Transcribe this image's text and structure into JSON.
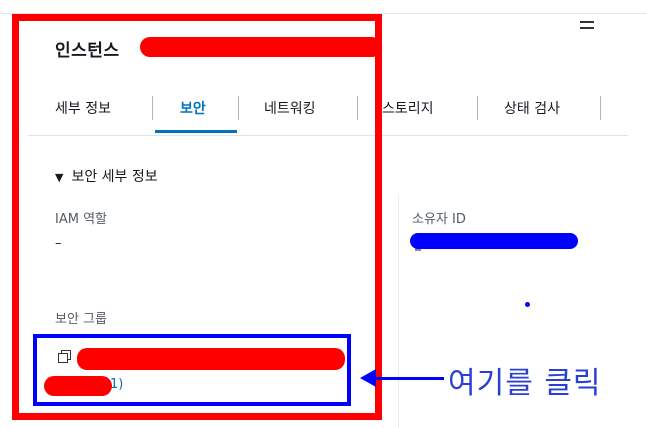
{
  "header": {
    "title": "인스턴스",
    "menu_icon": "hamburger-menu-icon"
  },
  "tabs": [
    {
      "label": "세부 정보",
      "active": false
    },
    {
      "label": "보안",
      "active": true
    },
    {
      "label": "네트워킹",
      "active": false
    },
    {
      "label": "스토리지",
      "active": false
    },
    {
      "label": "상태 검사",
      "active": false
    }
  ],
  "security_details": {
    "section_title": "보안 세부 정보",
    "iam_role_label": "IAM 역할",
    "iam_role_value": "–",
    "owner_id_label": "소유자 ID",
    "security_groups_label": "보안 그룹",
    "security_group_link_suffix": "1)"
  },
  "annotation": {
    "text": "여기를 클릭",
    "frame_color": "#ff0000",
    "highlight_color": "#0000ff"
  },
  "colors": {
    "accent": "#0073bb",
    "redaction": "#ff0000",
    "annotation_blue": "#0000ff"
  }
}
